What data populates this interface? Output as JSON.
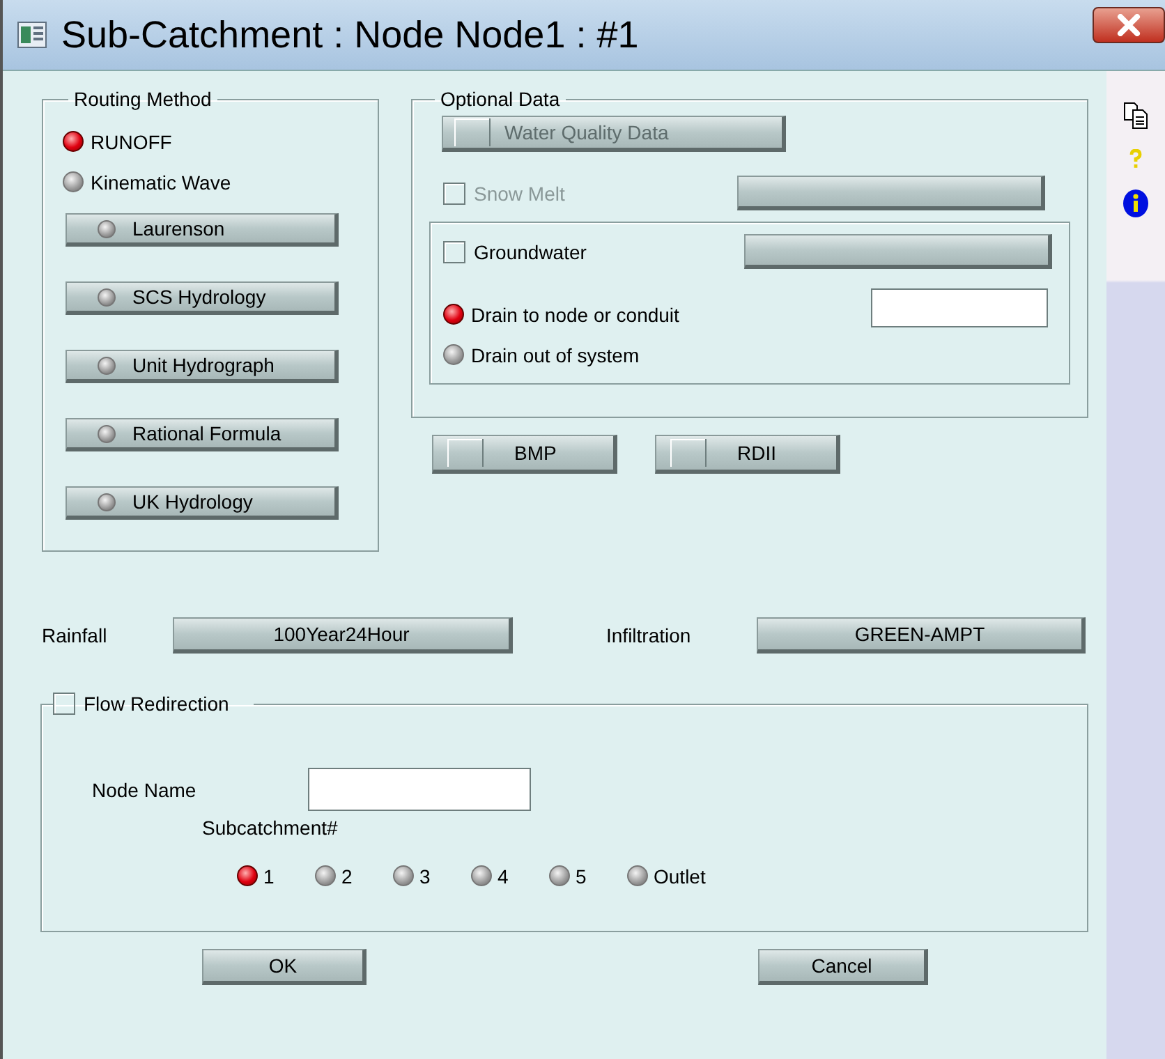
{
  "window": {
    "title": "Sub-Catchment : Node Node1 : #1"
  },
  "routing_method": {
    "label": "Routing Method",
    "options": [
      {
        "label": "RUNOFF",
        "selected": true
      },
      {
        "label": "Kinematic Wave",
        "selected": false
      }
    ],
    "methods": [
      {
        "label": "Laurenson",
        "selected": false
      },
      {
        "label": "SCS Hydrology",
        "selected": false
      },
      {
        "label": "Unit Hydrograph",
        "selected": false
      },
      {
        "label": "Rational Formula",
        "selected": false
      },
      {
        "label": "UK Hydrology",
        "selected": false
      }
    ]
  },
  "optional_data": {
    "label": "Optional Data",
    "water_quality": {
      "label": "Water Quality Data",
      "checked": false,
      "disabled": true
    },
    "snow_melt": {
      "label": "Snow Melt",
      "checked": false,
      "disabled": true
    },
    "groundwater": {
      "label": "Groundwater",
      "checked": false
    },
    "drain_options": [
      {
        "label": "Drain to node or conduit",
        "selected": true
      },
      {
        "label": "Drain out of system",
        "selected": false
      }
    ]
  },
  "extras": [
    {
      "label": "BMP",
      "checked": false
    },
    {
      "label": "RDII",
      "checked": false
    }
  ],
  "rainfall": {
    "label": "Rainfall",
    "value": "100Year24Hour"
  },
  "infiltration": {
    "label": "Infiltration",
    "value": "GREEN-AMPT"
  },
  "flow_redirection": {
    "label": "Flow Redirection",
    "checked": false,
    "node_name_label": "Node Name",
    "subcatchment_label": "Subcatchment#",
    "options": [
      {
        "label": "1",
        "selected": true
      },
      {
        "label": "2",
        "selected": false
      },
      {
        "label": "3",
        "selected": false
      },
      {
        "label": "4",
        "selected": false
      },
      {
        "label": "5",
        "selected": false
      },
      {
        "label": "Outlet",
        "selected": false
      }
    ]
  },
  "buttons": [
    {
      "label": "OK"
    },
    {
      "label": "Cancel"
    }
  ]
}
